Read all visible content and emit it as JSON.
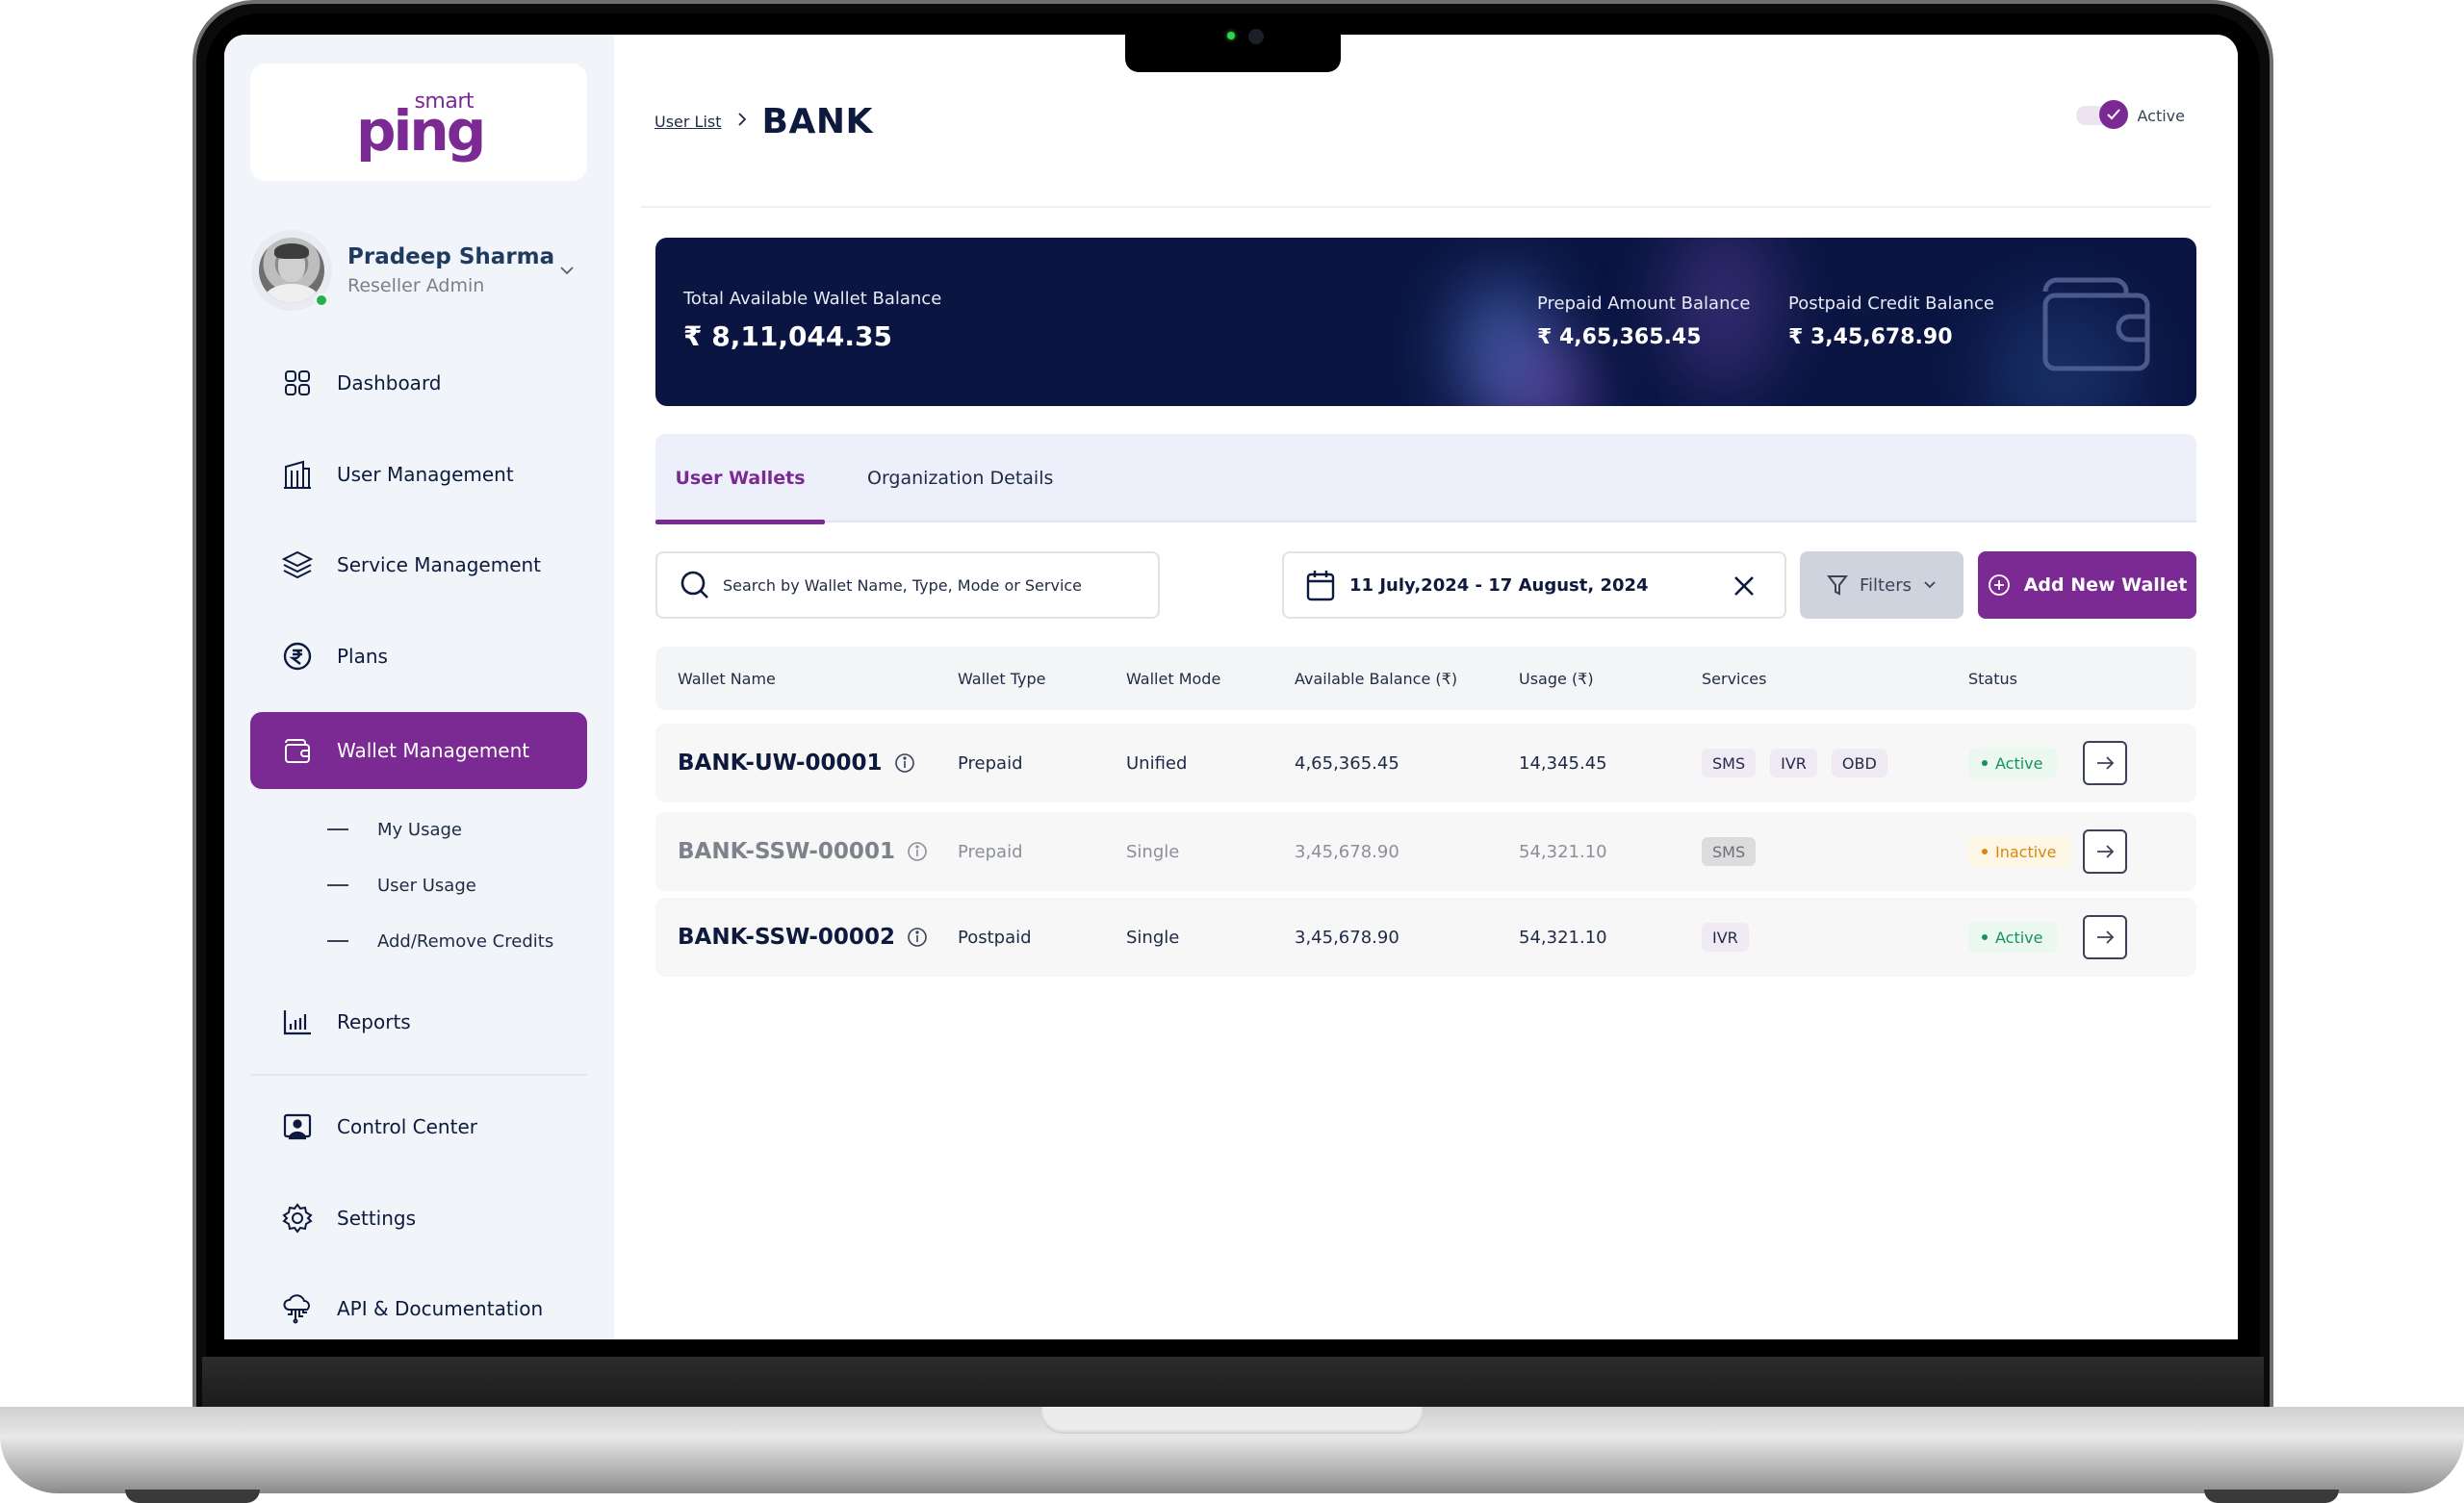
{
  "brand": {
    "logo_top": "smart",
    "logo_main": "ping",
    "accent_color": "#7b2a93",
    "navy_color": "#0a1542"
  },
  "profile": {
    "name": "Pradeep Sharma",
    "role": "Reseller Admin",
    "online": true
  },
  "sidebar": {
    "items": [
      {
        "label": "Dashboard",
        "icon": "grid-icon",
        "active": false
      },
      {
        "label": "User Management",
        "icon": "building-icon",
        "active": false
      },
      {
        "label": "Service Management",
        "icon": "layers-icon",
        "active": false
      },
      {
        "label": "Plans",
        "icon": "rupee-circle-icon",
        "active": false
      },
      {
        "label": "Wallet Management",
        "icon": "wallet-icon",
        "active": true
      },
      {
        "label": "Reports",
        "icon": "bar-chart-icon",
        "active": false
      },
      {
        "label": "Control Center",
        "icon": "presenter-icon",
        "active": false
      },
      {
        "label": "Settings",
        "icon": "gear-icon",
        "active": false
      },
      {
        "label": "API & Documentation",
        "icon": "cloud-api-icon",
        "active": false
      }
    ],
    "subitems": [
      {
        "label": "My Usage"
      },
      {
        "label": "User Usage"
      },
      {
        "label": "Add/Remove Credits"
      }
    ]
  },
  "header": {
    "breadcrumb_link": "User List",
    "title": "BANK",
    "status_label": "Active",
    "status_on": true
  },
  "balances": {
    "total_label": "Total Available Wallet Balance",
    "total_value": "₹ 8,11,044.35",
    "prepaid_label": "Prepaid Amount Balance",
    "prepaid_value": "₹ 4,65,365.45",
    "postpaid_label": "Postpaid Credit Balance",
    "postpaid_value": "₹ 3,45,678.90"
  },
  "tabs": [
    {
      "label": "User Wallets",
      "active": true
    },
    {
      "label": "Organization Details",
      "active": false
    }
  ],
  "toolbar": {
    "search_placeholder": "Search by Wallet Name, Type, Mode or Service",
    "search_value": "",
    "date_range": "11 July,2024 - 17 August, 2024",
    "filters_label": "Filters",
    "add_label": "Add New Wallet"
  },
  "table": {
    "columns": [
      "Wallet Name",
      "Wallet Type",
      "Wallet Mode",
      "Available Balance (₹)",
      "Usage (₹)",
      "Services",
      "Status"
    ],
    "rows": [
      {
        "name": "BANK-UW-00001",
        "type": "Prepaid",
        "mode": "Unified",
        "balance": "4,65,365.45",
        "usage": "14,345.45",
        "services": [
          "SMS",
          "IVR",
          "OBD"
        ],
        "status": "Active",
        "dim": false
      },
      {
        "name": "BANK-SSW-00001",
        "type": "Prepaid",
        "mode": "Single",
        "balance": "3,45,678.90",
        "usage": "54,321.10",
        "services": [
          "SMS"
        ],
        "status": "Inactive",
        "dim": true
      },
      {
        "name": "BANK-SSW-00002",
        "type": "Postpaid",
        "mode": "Single",
        "balance": "3,45,678.90",
        "usage": "54,321.10",
        "services": [
          "IVR"
        ],
        "status": "Active",
        "dim": false
      }
    ]
  }
}
